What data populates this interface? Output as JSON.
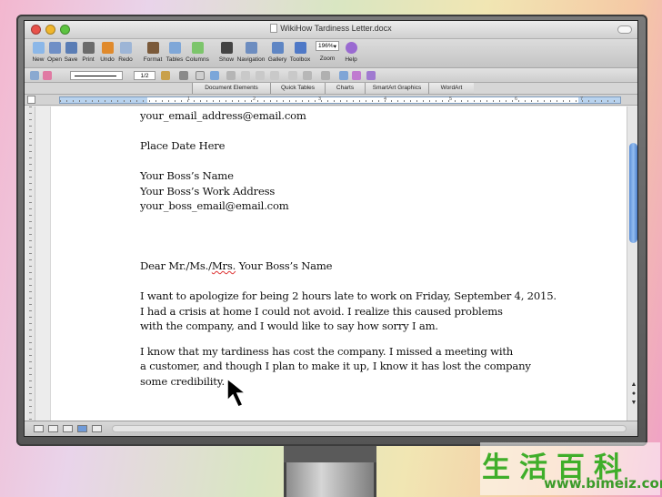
{
  "window": {
    "title": "WikiHow Tardiness Letter.docx"
  },
  "toolbar": {
    "buttons": [
      {
        "label": "New",
        "icon": "new-document-icon",
        "color": "#8bb7e8"
      },
      {
        "label": "Open",
        "icon": "open-folder-icon",
        "color": "#6f8fc6"
      },
      {
        "label": "Save",
        "icon": "save-disk-icon",
        "color": "#5a7db5"
      },
      {
        "label": "Print",
        "icon": "printer-icon",
        "color": "#6b6b6b"
      },
      {
        "label": "Undo",
        "icon": "undo-icon",
        "color": "#e08a2c"
      },
      {
        "label": "Redo",
        "icon": "redo-icon",
        "color": "#9db5d6"
      },
      {
        "label": "Format",
        "icon": "format-brush-icon",
        "color": "#7b5a3a"
      },
      {
        "label": "Tables",
        "icon": "table-icon",
        "color": "#7fa7d8"
      },
      {
        "label": "Columns",
        "icon": "columns-icon",
        "color": "#7cc56b"
      },
      {
        "label": "Show",
        "icon": "pilcrow-icon",
        "color": "#444444"
      },
      {
        "label": "Navigation",
        "icon": "navigation-pane-icon",
        "color": "#6d8dc0"
      },
      {
        "label": "Gallery",
        "icon": "gallery-icon",
        "color": "#5f86c4"
      },
      {
        "label": "Toolbox",
        "icon": "toolbox-icon",
        "color": "#4f79c7"
      }
    ],
    "zoom": {
      "value": "196%",
      "label": "Zoom"
    },
    "help": {
      "label": "Help",
      "icon": "help-icon",
      "color": "#9a6ad1"
    }
  },
  "formatbar": {
    "line_weight": "1/2"
  },
  "ribbon": {
    "tabs": [
      "Document Elements",
      "Quick Tables",
      "Charts",
      "SmartArt Graphics",
      "WordArt"
    ]
  },
  "ruler": {
    "numbers": [
      "1",
      "2",
      "3",
      "4",
      "5",
      "6",
      "7"
    ]
  },
  "letter": {
    "email": "your_email_address@email.com",
    "date": "Place Date Here",
    "boss_name": "Your Boss’s Name",
    "boss_address": "Your Boss’s Work Address",
    "boss_email": "your_boss_email@email.com",
    "salutation_pre": "Dear Mr./Ms./",
    "salutation_mrs": "Mrs.",
    "salutation_post": " Your Boss’s Name",
    "para1": [
      "I want to apologize for being 2 hours late to work on Friday, September 4, 2015.",
      "I had a crisis at home I could not avoid. I realize this caused problems",
      "with the company, and I would like to say how sorry I am."
    ],
    "para2": [
      "I know that my tardiness has cost the company. I missed a meeting with",
      "a customer, and though I plan to make it up, I know it has lost the company",
      "some credibility."
    ]
  },
  "watermark": {
    "cn": "生活百科",
    "url": "www.bimeiz.com"
  }
}
